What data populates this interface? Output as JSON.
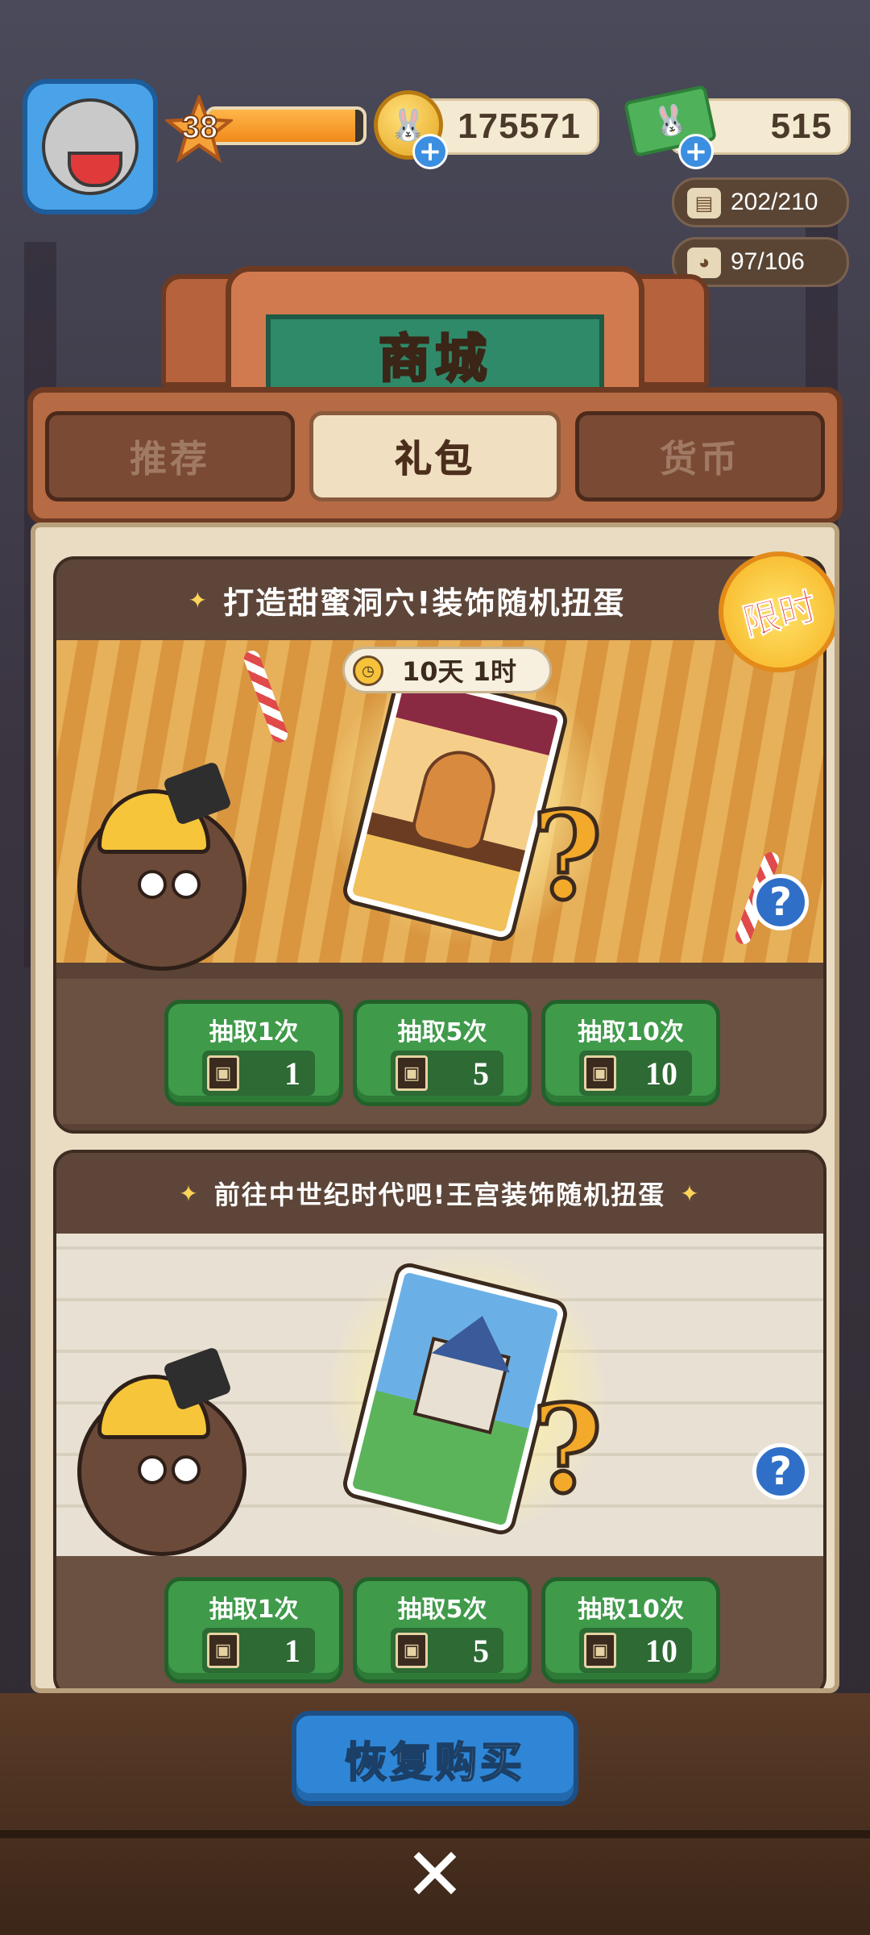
{
  "hud": {
    "level": "38",
    "level_progress": 0.95,
    "coins": "175571",
    "cash": "515",
    "storage": "202/210",
    "population": "97/106"
  },
  "shop": {
    "title": "商城",
    "tabs": [
      {
        "label": "推荐",
        "active": false
      },
      {
        "label": "礼包",
        "active": true
      },
      {
        "label": "货币",
        "active": false
      }
    ]
  },
  "cards": [
    {
      "title": "打造甜蜜洞穴!装饰随机扭蛋",
      "badge": "限时",
      "timer": "10天 1时",
      "buttons": [
        {
          "label": "抽取1次",
          "cost": "1"
        },
        {
          "label": "抽取5次",
          "cost": "5"
        },
        {
          "label": "抽取10次",
          "cost": "10"
        }
      ]
    },
    {
      "title": "前往中世纪时代吧!王宫装饰随机扭蛋",
      "buttons": [
        {
          "label": "抽取1次",
          "cost": "1"
        },
        {
          "label": "抽取5次",
          "cost": "5"
        },
        {
          "label": "抽取10次",
          "cost": "10"
        }
      ]
    }
  ],
  "footer": {
    "restore_label": "恢复购买",
    "close_glyph": "✕"
  },
  "icons": [
    "avatar",
    "star-icon",
    "coin-icon",
    "cash-icon",
    "plus-icon",
    "chest-icon",
    "bunny-icon",
    "clock-icon",
    "ticket-icon",
    "help-icon",
    "close-icon"
  ]
}
